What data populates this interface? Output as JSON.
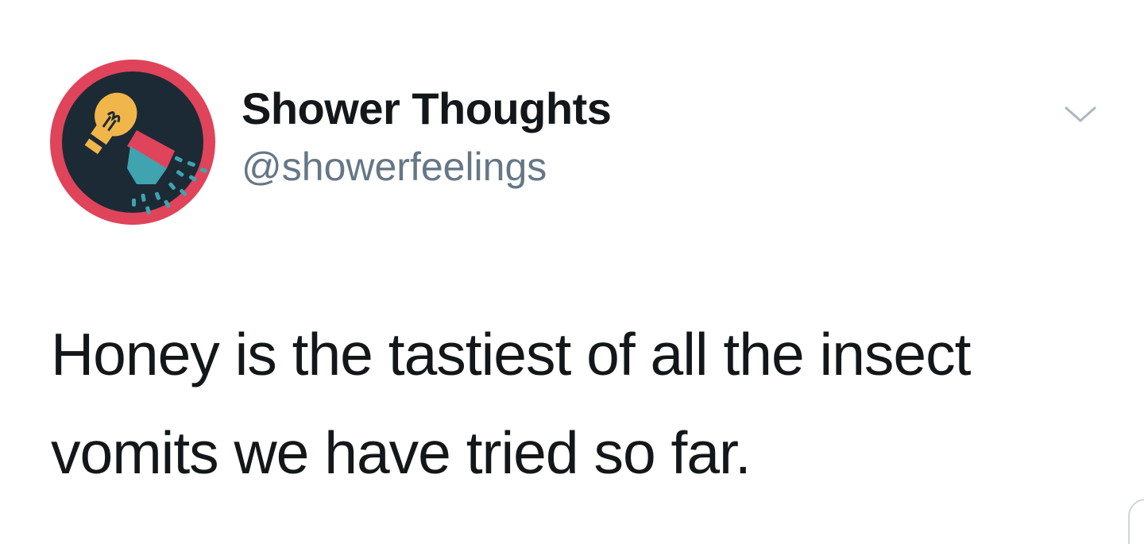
{
  "tweet": {
    "display_name": "Shower Thoughts",
    "handle": "@showerfeelings",
    "text_lines": [
      "Honey is the tastiest of all the insect",
      "vomits we have tried so far."
    ]
  },
  "icons": {
    "avatar": "showerhead-lightbulb-logo",
    "menu": "chevron-down-icon"
  },
  "colors": {
    "background": "#ffffff",
    "name": "#14171a",
    "handle": "#657786",
    "caret": "#aab8c2",
    "avatar_ring": "#e0445a",
    "avatar_bg": "#1c2a36",
    "bulb": "#f1b64a",
    "water": "#3fa3b0"
  }
}
